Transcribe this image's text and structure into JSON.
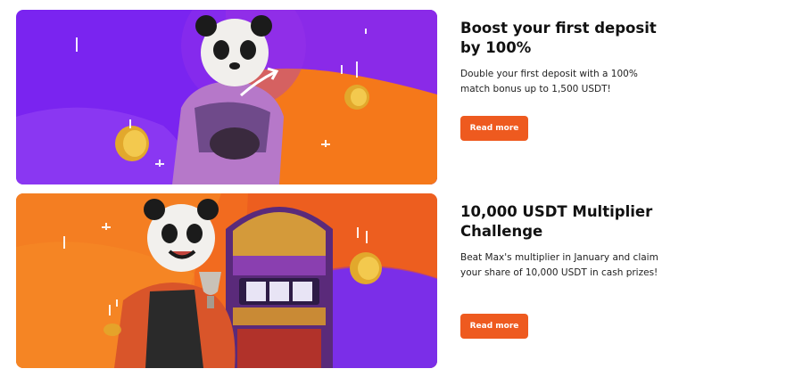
{
  "promotions": [
    {
      "title": "Boost your first deposit by 100%",
      "description": "Double your first deposit with a 100% match bonus up to 1,500 USDT!",
      "button_label": "Read more"
    },
    {
      "title": "10,000 USDT Multiplier Challenge",
      "description": "Beat Max's multiplier in January and claim your share of 10,000 USDT in cash prizes!",
      "button_label": "Read more"
    }
  ],
  "colors": {
    "purple": "#7a24f0",
    "orange": "#f5781a",
    "button": "#ee5a1f"
  }
}
